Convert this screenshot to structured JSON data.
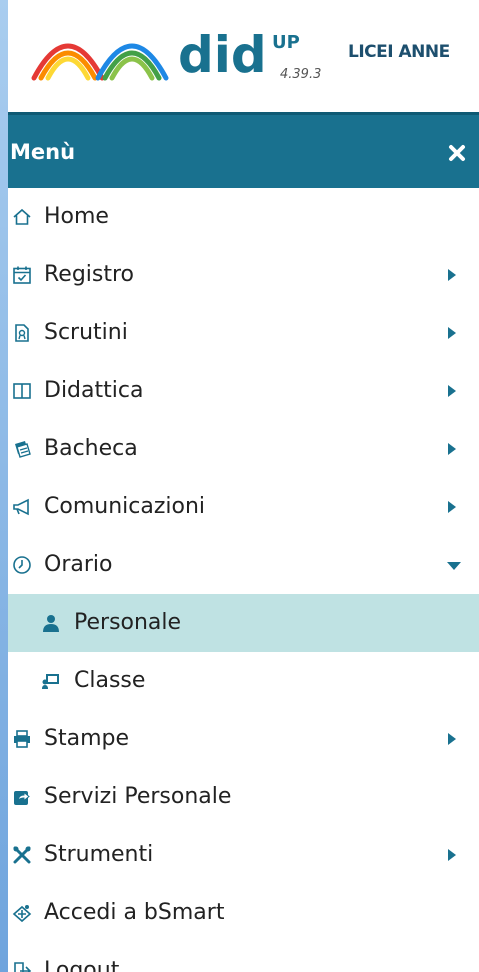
{
  "header": {
    "brand_main": "did",
    "brand_sup": "UP",
    "version": "4.39.3",
    "school": "LICEI ANNE"
  },
  "menu": {
    "title": "Menù",
    "items": [
      {
        "label": "Home",
        "icon": "home-icon",
        "has_arrow": false
      },
      {
        "label": "Registro",
        "icon": "calendar-check-icon",
        "has_arrow": true
      },
      {
        "label": "Scrutini",
        "icon": "report-card-icon",
        "has_arrow": true
      },
      {
        "label": "Didattica",
        "icon": "book-open-icon",
        "has_arrow": true
      },
      {
        "label": "Bacheca",
        "icon": "noticeboard-icon",
        "has_arrow": true
      },
      {
        "label": "Comunicazioni",
        "icon": "megaphone-icon",
        "has_arrow": true
      },
      {
        "label": "Orario",
        "icon": "clock-icon",
        "has_arrow": true,
        "expanded": true
      },
      {
        "label": "Personale",
        "icon": "user-icon",
        "sub": true,
        "active": true
      },
      {
        "label": "Classe",
        "icon": "classroom-icon",
        "sub": true
      },
      {
        "label": "Stampe",
        "icon": "printer-icon",
        "has_arrow": true
      },
      {
        "label": "Servizi Personale",
        "icon": "share-icon",
        "has_arrow": false
      },
      {
        "label": "Strumenti",
        "icon": "tools-icon",
        "has_arrow": true
      },
      {
        "label": "Accedi a bSmart",
        "icon": "bsmart-icon",
        "has_arrow": false
      },
      {
        "label": "Logout",
        "icon": "logout-icon",
        "has_arrow": false
      }
    ]
  },
  "colors": {
    "primary": "#19718f",
    "active_bg": "#bfe2e3",
    "page_bg": "#7fb2e6"
  }
}
